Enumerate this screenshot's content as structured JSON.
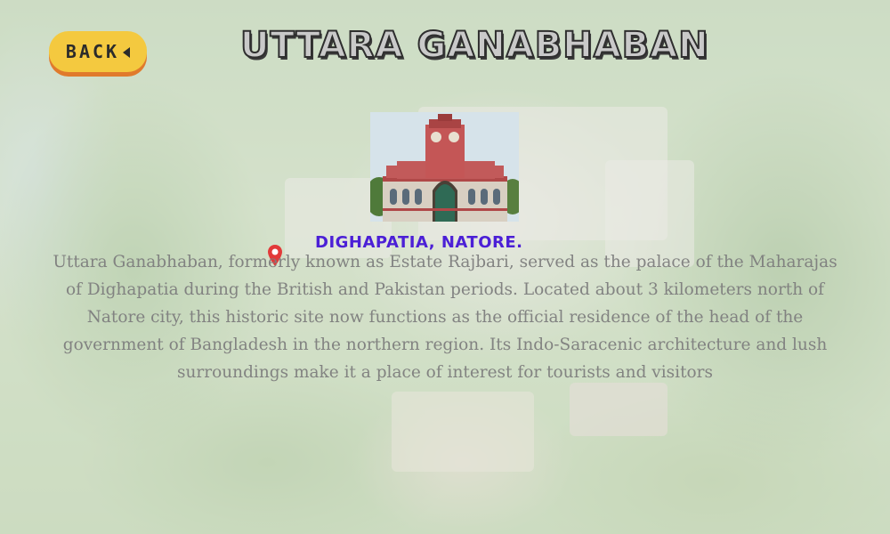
{
  "header": {
    "back_label": "BACK",
    "title": "UTTARA GANABHABAN"
  },
  "location": {
    "text": "DIGHAPATIA, NATORE."
  },
  "description": {
    "text": "Uttara Ganabhaban, formerly known as Estate Rajbari, served as the palace of the Maharajas of Dighapatia during the British and Pakistan periods. Located about 3 kilometers north of Natore city, this historic site now functions as the official residence of the head of the government of Bangladesh in the northern region. Its Indo-Saracenic architecture and lush surroundings make it a place of interest for tourists and visitors"
  },
  "colors": {
    "back_button": "#f4c93f",
    "back_button_shadow": "#e07a2c",
    "location_text": "#4b1fd6",
    "pin": "#e23a3a"
  },
  "icons": {
    "back": "triangle-left-icon",
    "location": "map-pin-icon"
  }
}
